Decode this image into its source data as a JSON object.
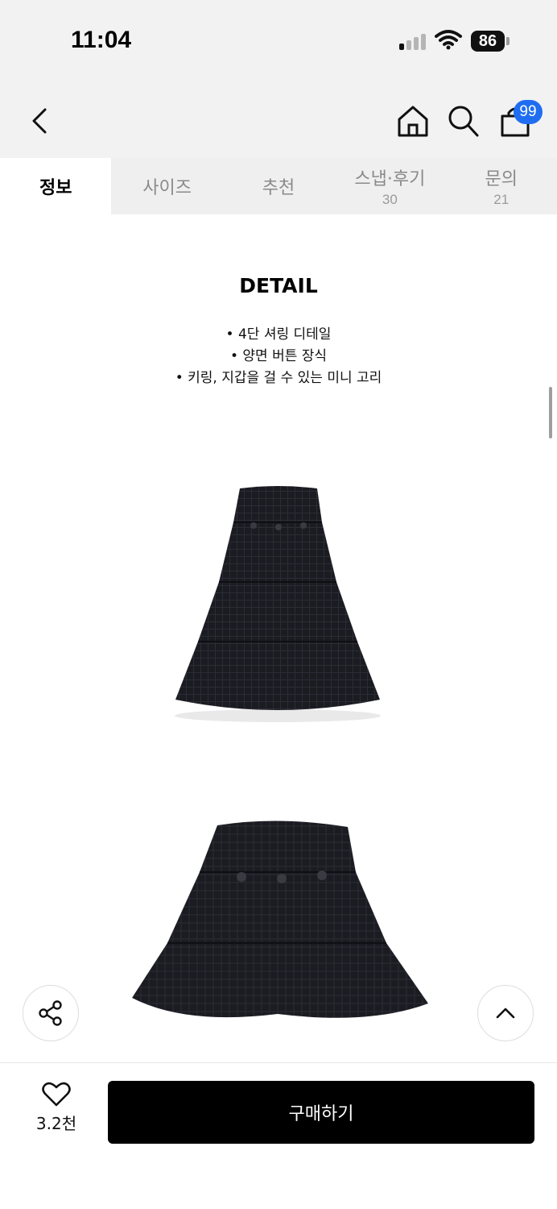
{
  "status_bar": {
    "time": "11:04",
    "battery": "86"
  },
  "header": {
    "cart_count": "99"
  },
  "tabs": [
    {
      "label": "정보",
      "count": "",
      "active": true
    },
    {
      "label": "사이즈",
      "count": ""
    },
    {
      "label": "추천",
      "count": ""
    },
    {
      "label": "스냅·후기",
      "count": "30"
    },
    {
      "label": "문의",
      "count": "21"
    }
  ],
  "detail": {
    "title": "DETAIL",
    "bullets": [
      "• 4단 셔링 디테일",
      "• 양면 버튼 장식",
      "• 키링, 지갑을 걸 수 있는 미니 고리"
    ]
  },
  "bottom_bar": {
    "like_count": "3.2천",
    "buy_label": "구매하기"
  },
  "colors": {
    "badge": "#1f6ef2",
    "buy_button": "#000000",
    "skirt": "#1b1b22"
  },
  "icons": [
    "back-arrow-icon",
    "home-icon",
    "search-icon",
    "shopping-bag-icon",
    "share-icon",
    "chevron-up-icon",
    "heart-icon"
  ]
}
